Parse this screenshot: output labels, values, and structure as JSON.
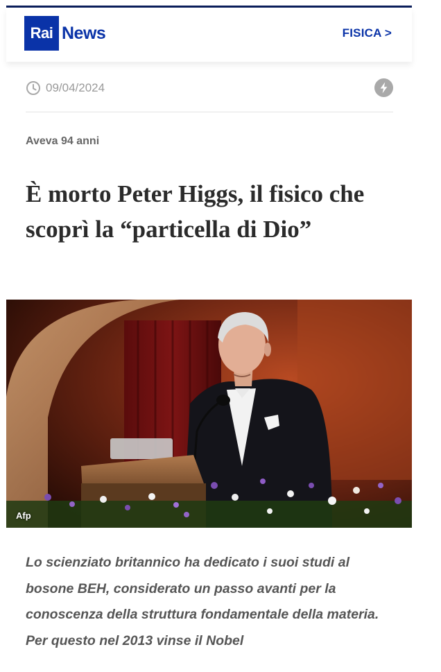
{
  "header": {
    "logo_box": "Rai",
    "logo_word": "News",
    "section_link": "FISICA >"
  },
  "meta": {
    "date": "09/04/2024",
    "date_icon": "clock-icon",
    "breaking_icon": "lightning-icon"
  },
  "article": {
    "kicker": "Aveva 94 anni",
    "title": "È morto Peter Higgs, il fisico che scoprì la “particella di Dio”",
    "photo_credit": "Afp",
    "summary": "Lo scienziato britannico ha dedicato i suoi studi al bosone BEH, considerato un passo avanti per la conoscenza della struttura fondamentale della materia. Per questo nel 2013 vinse il Nobel"
  },
  "colors": {
    "brand_blue": "#0a33a8",
    "top_rule": "#0b1e5b",
    "title_text": "#2b2b2b",
    "muted_text": "#9a9a9a"
  }
}
